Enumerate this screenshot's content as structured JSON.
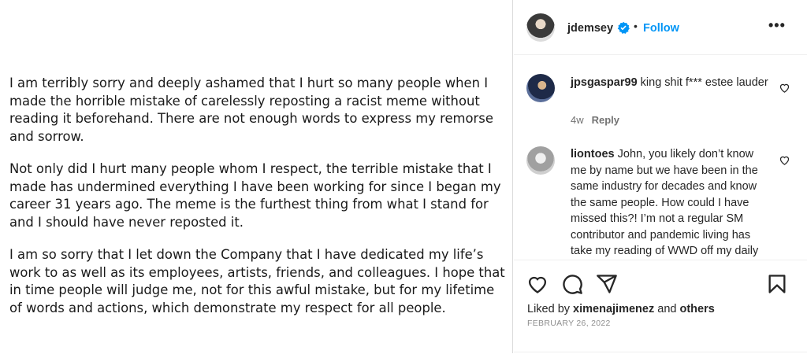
{
  "statement": {
    "paragraphs": [
      "I am terribly sorry and deeply ashamed that I hurt so many people when I made the horrible mistake of carelessly reposting a racist meme without reading it beforehand. There are not enough words to express my remorse and sorrow.",
      "Not only did I hurt many people whom I respect, the terrible mistake that I made has undermined everything I have been working for since I began my career 31 years ago.  The meme is the furthest thing from what I stand for and I should have never reposted it.",
      "I am so sorry that I let down the Company that I have dedicated my life’s work to as well as its employees, artists, friends, and colleagues.  I hope that in time people will judge me, not for this awful mistake, but for my lifetime of words and actions, which demonstrate my respect for all people."
    ]
  },
  "header": {
    "username": "jdemsey",
    "separator": "•",
    "follow_label": "Follow",
    "more_label": "•••"
  },
  "comments": [
    {
      "username": "jpsgaspar99",
      "text": "king shit f*** estee lauder",
      "age": "4w",
      "reply_label": "Reply"
    },
    {
      "username": "liontoes",
      "text": "John, you likely don’t know me by name but we have been in the same industry for decades and know the same people. How could I have missed this?! I’m not a regular SM contributor and pandemic living has take my reading of WWD off my daily to-do list so you must"
    }
  ],
  "footer": {
    "liked_prefix": "Liked by",
    "liked_user": "ximenajimenez",
    "liked_and": "and",
    "liked_others": "others",
    "date": "FEBRUARY 26, 2022"
  },
  "icons": {
    "verified": "verified-badge-icon",
    "like": "heart-icon",
    "comment": "comment-bubble-icon",
    "share": "paper-plane-icon",
    "save": "bookmark-icon"
  },
  "colors": {
    "accent": "#0095f6",
    "text": "#262626",
    "muted": "#737373"
  }
}
